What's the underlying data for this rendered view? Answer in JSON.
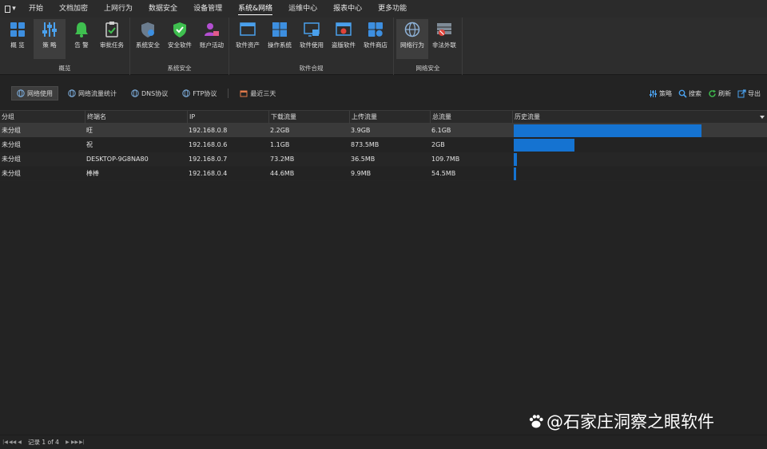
{
  "menubar": {
    "app_icon": "app-menu-icon",
    "tabs": [
      {
        "label": "开始"
      },
      {
        "label": "文档加密"
      },
      {
        "label": "上网行为"
      },
      {
        "label": "数据安全"
      },
      {
        "label": "设备管理"
      },
      {
        "label": "系统&网络",
        "active": true
      },
      {
        "label": "运维中心"
      },
      {
        "label": "报表中心"
      },
      {
        "label": "更多功能"
      }
    ]
  },
  "ribbon": {
    "groups": [
      {
        "title": "概览",
        "buttons": [
          {
            "label": "概 览",
            "icon": "grid-overview-icon"
          },
          {
            "label": "策 略",
            "icon": "sliders-policy-icon",
            "selected": true
          },
          {
            "label": "告 警",
            "icon": "bell-alert-icon"
          },
          {
            "label": "审批任务",
            "icon": "clipboard-check-icon"
          }
        ]
      },
      {
        "title": "系统安全",
        "buttons": [
          {
            "label": "系统安全",
            "icon": "shield-gear-icon"
          },
          {
            "label": "安全软件",
            "icon": "shield-check-icon"
          },
          {
            "label": "账户活动",
            "icon": "user-lock-icon"
          }
        ]
      },
      {
        "title": "软件合规",
        "buttons": [
          {
            "label": "软件资产",
            "icon": "window-asset-icon"
          },
          {
            "label": "操作系统",
            "icon": "windows-logo-icon"
          },
          {
            "label": "软件使用",
            "icon": "monitor-app-icon"
          },
          {
            "label": "盗版软件",
            "icon": "window-warning-icon"
          },
          {
            "label": "软件商店",
            "icon": "store-apps-icon"
          }
        ]
      },
      {
        "title": "网络安全",
        "buttons": [
          {
            "label": "网络行为",
            "icon": "globe-network-icon",
            "selected": true
          },
          {
            "label": "非法外联",
            "icon": "firewall-icon"
          }
        ]
      }
    ]
  },
  "subtoolbar": {
    "tabs": [
      {
        "label": "网络使用",
        "icon": "globe-icon",
        "active": true
      },
      {
        "label": "网络流量统计",
        "icon": "globe-icon"
      },
      {
        "label": "DNS协议",
        "icon": "globe-icon"
      },
      {
        "label": "FTP协议",
        "icon": "globe-icon"
      }
    ],
    "date_range": {
      "label": "最近三天",
      "icon": "calendar-icon"
    },
    "tools": [
      {
        "label": "策略",
        "icon": "sliders-icon"
      },
      {
        "label": "搜索",
        "icon": "search-icon"
      },
      {
        "label": "刷新",
        "icon": "refresh-icon"
      },
      {
        "label": "导出",
        "icon": "export-icon"
      }
    ]
  },
  "table": {
    "columns": [
      "分组",
      "终端名",
      "IP",
      "下载流量",
      "上传流量",
      "总流量",
      "历史流量"
    ],
    "rows": [
      {
        "group": "未分组",
        "terminal": "旺",
        "ip": "192.168.0.8",
        "download": "2.2GB",
        "upload": "3.9GB",
        "total": "6.1GB",
        "history_fraction": 0.745
      },
      {
        "group": "未分组",
        "terminal": "祝",
        "ip": "192.168.0.6",
        "download": "1.1GB",
        "upload": "873.5MB",
        "total": "2GB",
        "history_fraction": 0.24
      },
      {
        "group": "未分组",
        "terminal": "DESKTOP-9G8NA80",
        "ip": "192.168.0.7",
        "download": "73.2MB",
        "upload": "36.5MB",
        "total": "109.7MB",
        "history_fraction": 0.012
      },
      {
        "group": "未分组",
        "terminal": "棒棒",
        "ip": "192.168.0.4",
        "download": "44.6MB",
        "upload": "9.9MB",
        "total": "54.5MB",
        "history_fraction": 0.008
      }
    ],
    "bar_color": "#1573d1"
  },
  "statusbar": {
    "record_text": "记录 1 of 4"
  },
  "watermark": {
    "text": "@石家庄洞察之眼软件"
  }
}
